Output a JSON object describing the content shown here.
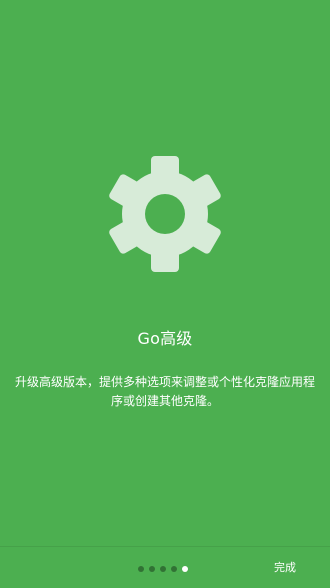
{
  "onboarding": {
    "title": "Go高级",
    "description": "升级高级版本，提供多种选项来调整或个性化克隆应用程序或创建其他克隆。",
    "icon": "gear-icon",
    "icon_color": "#d7ebd8",
    "background_color": "#4caf50"
  },
  "pager": {
    "total_pages": 5,
    "current_page": 5
  },
  "footer": {
    "done_label": "完成"
  }
}
